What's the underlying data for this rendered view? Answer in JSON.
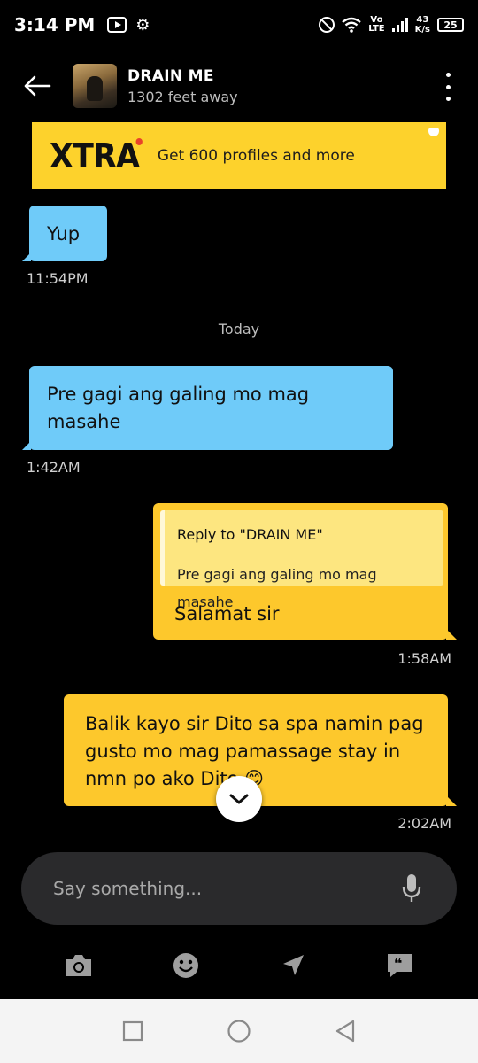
{
  "status_bar": {
    "time": "3:14 PM",
    "net_speed_value": "43",
    "net_speed_unit": "K/s",
    "volte_top": "Vo",
    "volte_bottom": "LTE",
    "battery": "25"
  },
  "header": {
    "contact_name": "DRAIN ME",
    "distance": "1302 feet away"
  },
  "banner": {
    "logo": "XTRA",
    "text": "Get 600 profiles and more"
  },
  "messages": {
    "m1": {
      "text": "Yup",
      "time": "11:54PM"
    },
    "day_divider": "Today",
    "m2": {
      "text": "Pre gagi ang galing mo mag masahe",
      "time": "1:42AM"
    },
    "m3": {
      "reply_to": "Reply to \"DRAIN ME\"",
      "reply_text": "Pre gagi ang galing mo mag masahe",
      "text": "Salamat sir",
      "time": "1:58AM"
    },
    "m4": {
      "text": "Balik kayo sir Dito sa spa namin pag gusto mo mag pamassage stay in nmn po ako Dito 😊",
      "time": "2:02AM"
    }
  },
  "composer": {
    "placeholder": "Say something..."
  },
  "colors": {
    "incoming_bubble": "#6fcbf9",
    "outgoing_bubble": "#fdc82c",
    "banner": "#fdd22c"
  }
}
